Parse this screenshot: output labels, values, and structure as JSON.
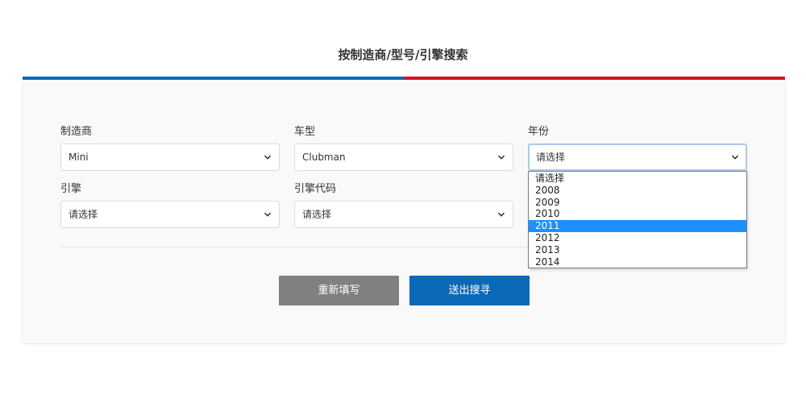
{
  "page": {
    "title": "按制造商/型号/引擎搜索"
  },
  "colors": {
    "accent_left": "#0b6ab8",
    "accent_right": "#d6121f",
    "reset_button": "#808080",
    "submit_button": "#0b6ab8",
    "option_highlight": "#1e90ff"
  },
  "form": {
    "manufacturer": {
      "label": "制造商",
      "value": "Mini"
    },
    "model": {
      "label": "车型",
      "value": "Clubman"
    },
    "year": {
      "label": "年份",
      "value": "请选择",
      "options": [
        "请选择",
        "2008",
        "2009",
        "2010",
        "2011",
        "2012",
        "2013",
        "2014"
      ],
      "highlighted_option": "2011"
    },
    "engine": {
      "label": "引擎",
      "value": "请选择"
    },
    "engine_code": {
      "label": "引擎代码",
      "value": "请选择"
    }
  },
  "buttons": {
    "reset_label": "重新填写",
    "submit_label": "送出搜寻"
  },
  "icons": {
    "dropdown_indicator": "chevron-down-icon"
  }
}
